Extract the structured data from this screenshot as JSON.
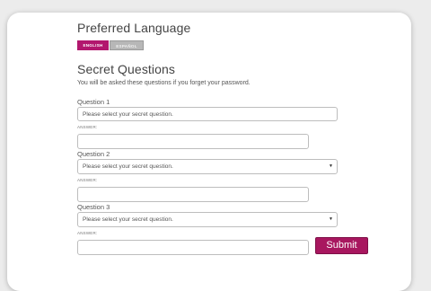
{
  "language": {
    "title": "Preferred Language",
    "english_label": "ENGLISH",
    "spanish_label": "ESPAÑOL"
  },
  "secret": {
    "title": "Secret Questions",
    "description": "You will be asked these questions if you forget your password.",
    "answer_label": "ANSWER:",
    "questions": [
      {
        "label": "Question 1",
        "selected": "Please select your secret question.",
        "answer": ""
      },
      {
        "label": "Question 2",
        "selected": "Please select your secret question.",
        "answer": ""
      },
      {
        "label": "Question 3",
        "selected": "Please select your secret question.",
        "answer": ""
      }
    ]
  },
  "submit_label": "Submit",
  "colors": {
    "accent": "#b2176e",
    "submit": "#a8175f",
    "background": "#ececec"
  }
}
